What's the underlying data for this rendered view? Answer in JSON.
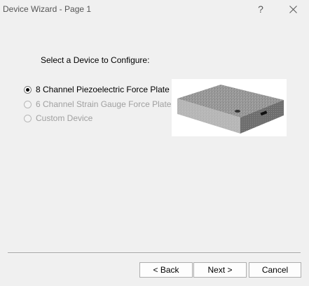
{
  "window": {
    "title": "Device Wizard - Page 1",
    "help_glyph": "?",
    "help_icon": "question-mark-icon",
    "close_icon": "close-icon"
  },
  "prompt": "Select a Device to Configure:",
  "options": [
    {
      "label": "8 Channel Piezoelectric Force Plate",
      "selected": true,
      "enabled": true
    },
    {
      "label": "6 Channel Strain Gauge Force Plate",
      "selected": false,
      "enabled": false
    },
    {
      "label": "Custom Device",
      "selected": false,
      "enabled": false
    }
  ],
  "buttons": {
    "back": "< Back",
    "next": "Next >",
    "cancel": "Cancel"
  },
  "colors": {
    "window_bg": "#f0f0f0",
    "disabled_text": "#a0a0a0"
  }
}
